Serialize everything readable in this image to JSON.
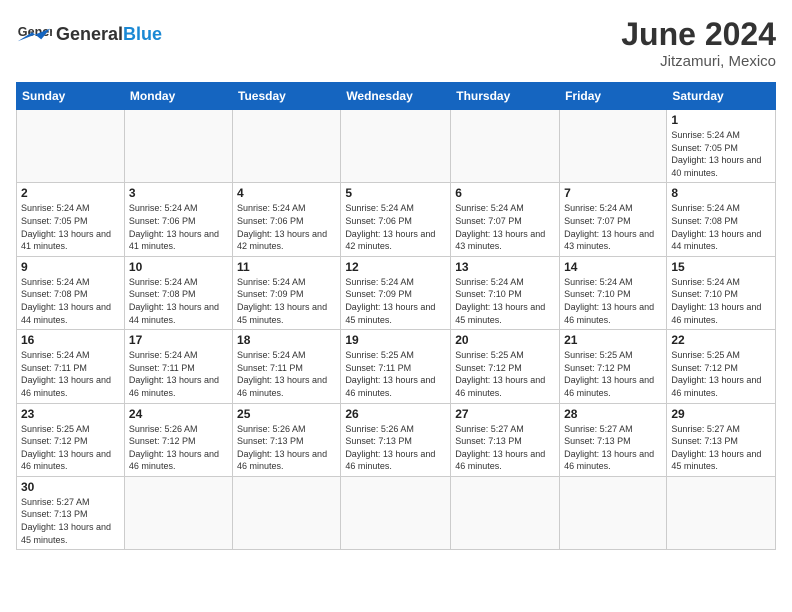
{
  "header": {
    "logo_general": "General",
    "logo_blue": "Blue",
    "month_title": "June 2024",
    "subtitle": "Jitzamuri, Mexico"
  },
  "weekdays": [
    "Sunday",
    "Monday",
    "Tuesday",
    "Wednesday",
    "Thursday",
    "Friday",
    "Saturday"
  ],
  "weeks": [
    [
      {
        "day": null
      },
      {
        "day": null
      },
      {
        "day": null
      },
      {
        "day": null
      },
      {
        "day": null
      },
      {
        "day": null
      },
      {
        "day": "1",
        "sunrise": "5:24 AM",
        "sunset": "7:05 PM",
        "daylight": "13 hours and 40 minutes."
      }
    ],
    [
      {
        "day": "2",
        "sunrise": "5:24 AM",
        "sunset": "7:05 PM",
        "daylight": "13 hours and 41 minutes."
      },
      {
        "day": "3",
        "sunrise": "5:24 AM",
        "sunset": "7:06 PM",
        "daylight": "13 hours and 41 minutes."
      },
      {
        "day": "4",
        "sunrise": "5:24 AM",
        "sunset": "7:06 PM",
        "daylight": "13 hours and 42 minutes."
      },
      {
        "day": "5",
        "sunrise": "5:24 AM",
        "sunset": "7:06 PM",
        "daylight": "13 hours and 42 minutes."
      },
      {
        "day": "6",
        "sunrise": "5:24 AM",
        "sunset": "7:07 PM",
        "daylight": "13 hours and 43 minutes."
      },
      {
        "day": "7",
        "sunrise": "5:24 AM",
        "sunset": "7:07 PM",
        "daylight": "13 hours and 43 minutes."
      },
      {
        "day": "8",
        "sunrise": "5:24 AM",
        "sunset": "7:08 PM",
        "daylight": "13 hours and 44 minutes."
      }
    ],
    [
      {
        "day": "9",
        "sunrise": "5:24 AM",
        "sunset": "7:08 PM",
        "daylight": "13 hours and 44 minutes."
      },
      {
        "day": "10",
        "sunrise": "5:24 AM",
        "sunset": "7:08 PM",
        "daylight": "13 hours and 44 minutes."
      },
      {
        "day": "11",
        "sunrise": "5:24 AM",
        "sunset": "7:09 PM",
        "daylight": "13 hours and 45 minutes."
      },
      {
        "day": "12",
        "sunrise": "5:24 AM",
        "sunset": "7:09 PM",
        "daylight": "13 hours and 45 minutes."
      },
      {
        "day": "13",
        "sunrise": "5:24 AM",
        "sunset": "7:10 PM",
        "daylight": "13 hours and 45 minutes."
      },
      {
        "day": "14",
        "sunrise": "5:24 AM",
        "sunset": "7:10 PM",
        "daylight": "13 hours and 46 minutes."
      },
      {
        "day": "15",
        "sunrise": "5:24 AM",
        "sunset": "7:10 PM",
        "daylight": "13 hours and 46 minutes."
      }
    ],
    [
      {
        "day": "16",
        "sunrise": "5:24 AM",
        "sunset": "7:11 PM",
        "daylight": "13 hours and 46 minutes."
      },
      {
        "day": "17",
        "sunrise": "5:24 AM",
        "sunset": "7:11 PM",
        "daylight": "13 hours and 46 minutes."
      },
      {
        "day": "18",
        "sunrise": "5:24 AM",
        "sunset": "7:11 PM",
        "daylight": "13 hours and 46 minutes."
      },
      {
        "day": "19",
        "sunrise": "5:25 AM",
        "sunset": "7:11 PM",
        "daylight": "13 hours and 46 minutes."
      },
      {
        "day": "20",
        "sunrise": "5:25 AM",
        "sunset": "7:12 PM",
        "daylight": "13 hours and 46 minutes."
      },
      {
        "day": "21",
        "sunrise": "5:25 AM",
        "sunset": "7:12 PM",
        "daylight": "13 hours and 46 minutes."
      },
      {
        "day": "22",
        "sunrise": "5:25 AM",
        "sunset": "7:12 PM",
        "daylight": "13 hours and 46 minutes."
      }
    ],
    [
      {
        "day": "23",
        "sunrise": "5:25 AM",
        "sunset": "7:12 PM",
        "daylight": "13 hours and 46 minutes."
      },
      {
        "day": "24",
        "sunrise": "5:26 AM",
        "sunset": "7:12 PM",
        "daylight": "13 hours and 46 minutes."
      },
      {
        "day": "25",
        "sunrise": "5:26 AM",
        "sunset": "7:13 PM",
        "daylight": "13 hours and 46 minutes."
      },
      {
        "day": "26",
        "sunrise": "5:26 AM",
        "sunset": "7:13 PM",
        "daylight": "13 hours and 46 minutes."
      },
      {
        "day": "27",
        "sunrise": "5:27 AM",
        "sunset": "7:13 PM",
        "daylight": "13 hours and 46 minutes."
      },
      {
        "day": "28",
        "sunrise": "5:27 AM",
        "sunset": "7:13 PM",
        "daylight": "13 hours and 46 minutes."
      },
      {
        "day": "29",
        "sunrise": "5:27 AM",
        "sunset": "7:13 PM",
        "daylight": "13 hours and 45 minutes."
      }
    ],
    [
      {
        "day": "30",
        "sunrise": "5:27 AM",
        "sunset": "7:13 PM",
        "daylight": "13 hours and 45 minutes."
      },
      {
        "day": null
      },
      {
        "day": null
      },
      {
        "day": null
      },
      {
        "day": null
      },
      {
        "day": null
      },
      {
        "day": null
      }
    ]
  ]
}
